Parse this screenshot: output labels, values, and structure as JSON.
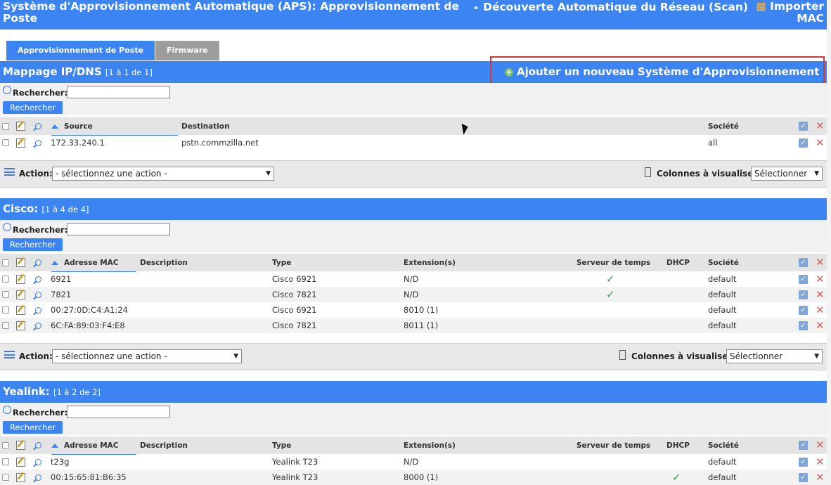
{
  "header": {
    "title": "Système d'Approvisionnement Automatique (APS):  Approvisionnement de Poste",
    "scan_label": "Découverte Automatique du Réseau (Scan)",
    "import_label": "Importer MAC"
  },
  "tabs": [
    {
      "label": "Approvisionnement de Poste",
      "active": true
    },
    {
      "label": "Firmware",
      "active": false
    }
  ],
  "add_system_label": "Ajouter un nouveau Système d'Approvisionnement",
  "common": {
    "search_label": "Rechercher:",
    "search_button": "Rechercher",
    "action_label": "Action:",
    "action_placeholder": "- sélectionnez une action -",
    "columns_label": "Colonnes à visualiser:",
    "columns_placeholder": "Sélectionner"
  },
  "sections": {
    "ipdns": {
      "name": "Mappage IP/DNS",
      "range": "[1 à 1 de 1]",
      "columns": [
        "Source",
        "Destination",
        "Société"
      ],
      "rows": [
        {
          "source": "172.33.240.1",
          "destination": "pstn.commzilla.net",
          "company": "all"
        }
      ]
    },
    "cisco": {
      "name": "Cisco:",
      "range": "[1 à 4 de 4]",
      "columns": [
        "Adresse MAC",
        "Description",
        "Type",
        "Extension(s)",
        "Serveur de temps",
        "DHCP",
        "Société"
      ],
      "rows": [
        {
          "mac": "6921",
          "desc": "",
          "type": "Cisco 6921",
          "ext": "N/D",
          "time_server": true,
          "dhcp": false,
          "company": "default"
        },
        {
          "mac": "7821",
          "desc": "",
          "type": "Cisco 7821",
          "ext": "N/D",
          "time_server": true,
          "dhcp": false,
          "company": "default"
        },
        {
          "mac": "00:27:0D:C4:A1:24",
          "desc": "",
          "type": "Cisco 6921",
          "ext": "8010 (1)",
          "time_server": false,
          "dhcp": false,
          "company": "default"
        },
        {
          "mac": "6C:FA:89:03:F4:E8",
          "desc": "",
          "type": "Cisco 7821",
          "ext": "8011 (1)",
          "time_server": false,
          "dhcp": false,
          "company": "default"
        }
      ]
    },
    "yealink": {
      "name": "Yealink:",
      "range": "[1 à 2 de 2]",
      "columns": [
        "Adresse MAC",
        "Description",
        "Type",
        "Extension(s)",
        "Serveur de temps",
        "DHCP",
        "Société"
      ],
      "rows": [
        {
          "mac": "t23g",
          "desc": "",
          "type": "Yealink T23",
          "ext": "N/D",
          "time_server": false,
          "dhcp": false,
          "company": "default"
        },
        {
          "mac": "00:15:65:81:B6:35",
          "desc": "",
          "type": "Yealink T23",
          "ext": "8000 (1)",
          "time_server": false,
          "dhcp": true,
          "company": "default"
        }
      ]
    }
  },
  "colors": {
    "accent": "#3c84f2",
    "inactive_tab": "#9d9d9d",
    "highlight": "#dd3333"
  }
}
